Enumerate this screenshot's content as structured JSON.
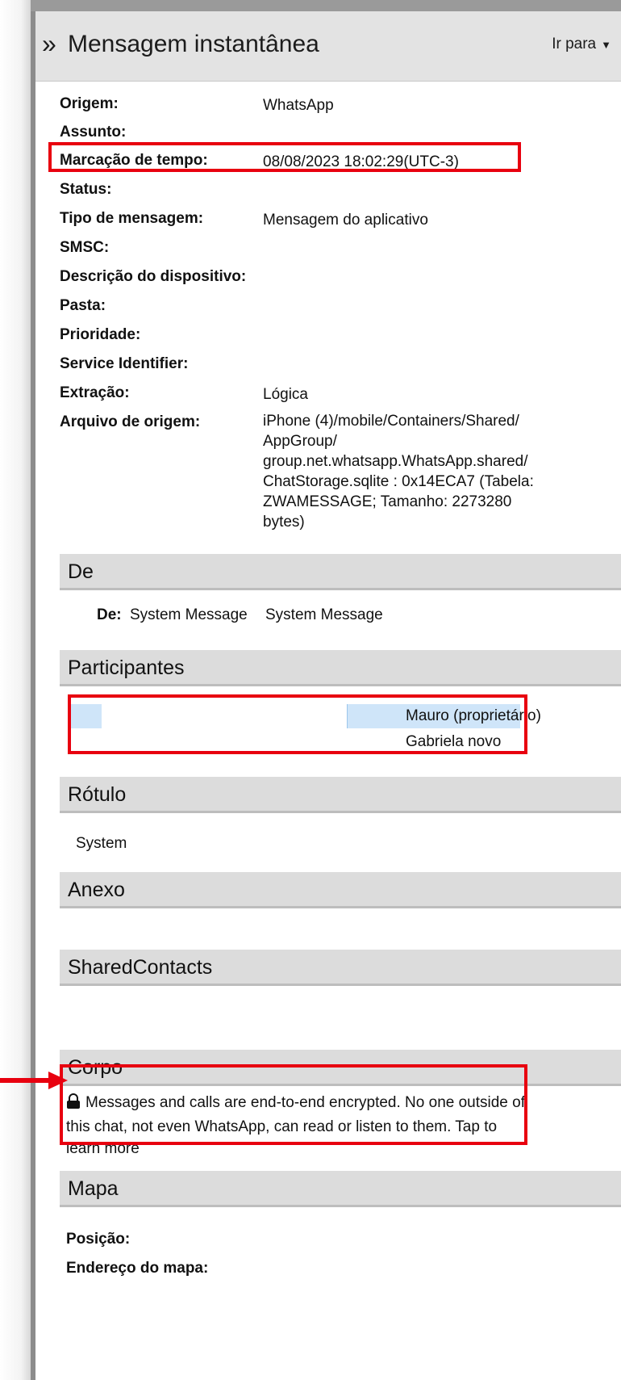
{
  "header": {
    "chevron": "»",
    "title": "Mensagem instantânea",
    "goto_label": "Ir para",
    "goto_caret": "▼"
  },
  "fields": {
    "origem": {
      "label": "Origem:",
      "value": "WhatsApp"
    },
    "assunto": {
      "label": "Assunto:",
      "value": ""
    },
    "timestamp": {
      "label": "Marcação de tempo:",
      "value": "08/08/2023 18:02:29(UTC-3)"
    },
    "status": {
      "label": "Status:",
      "value": ""
    },
    "tipo": {
      "label": "Tipo de mensagem:",
      "value": "Mensagem do aplicativo"
    },
    "smsc": {
      "label": "SMSC:",
      "value": ""
    },
    "descricao": {
      "label": "Descrição do dispositivo:",
      "value": ""
    },
    "pasta": {
      "label": "Pasta:",
      "value": ""
    },
    "prioridade": {
      "label": "Prioridade:",
      "value": ""
    },
    "service": {
      "label": "Service Identifier:",
      "value": ""
    },
    "extracao": {
      "label": "Extração:",
      "value": "Lógica"
    },
    "arquivo": {
      "label": "Arquivo de origem:",
      "value_lines": [
        "iPhone (4)/mobile/Containers/Shared/",
        "AppGroup/",
        "group.net.whatsapp.WhatsApp.shared/",
        "ChatStorage.sqlite : 0x14ECA7 (Tabela:",
        "ZWAMESSAGE; Tamanho: 2273280",
        "bytes)"
      ]
    }
  },
  "sections": {
    "de": "De",
    "participantes": "Participantes",
    "rotulo": "Rótulo",
    "anexo": "Anexo",
    "shared_contacts": "SharedContacts",
    "corpo": "Corpo",
    "mapa": "Mapa"
  },
  "de": {
    "label": "De:",
    "value1": "System Message",
    "value2": "System Message"
  },
  "participants": [
    {
      "name": "Mauro (proprietário)"
    },
    {
      "name": "Gabriela novo"
    }
  ],
  "rotulo": {
    "value": "System"
  },
  "corpo": {
    "text": "Messages and calls are end-to-end encrypted. No one outside of this chat, not even WhatsApp, can read or listen to them. Tap to learn more"
  },
  "mapa": {
    "posicao_label": "Posição:",
    "endereco_label": "Endereço do mapa:"
  },
  "colors": {
    "highlight_red": "#e8000f",
    "selection_blue": "#cfe5f9",
    "header_gray": "#dcdcdc"
  },
  "icons": {
    "lock": "lock-icon",
    "arrow": "red-arrow-icon",
    "chevron": "double-chevron-icon"
  }
}
